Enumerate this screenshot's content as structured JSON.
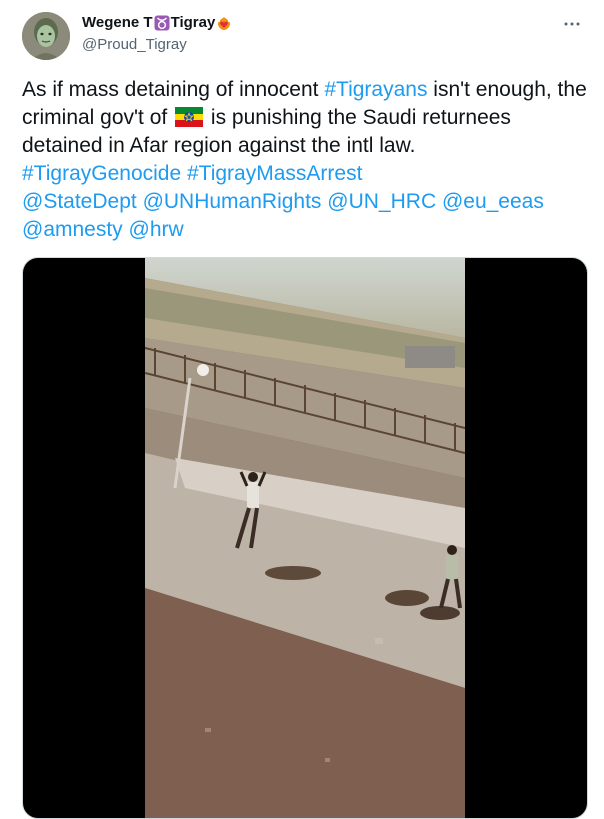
{
  "author": {
    "name_before": "Wegene T",
    "name_after": "Tigray",
    "handle": "@Proud_Tigray",
    "name_emoji": [
      "taurus-sign-icon",
      "heart-on-fire-icon"
    ]
  },
  "tweet": {
    "segments": [
      {
        "text": "As if mass detaining of innocent ",
        "type": "text"
      },
      {
        "text": "#Tigrayans",
        "type": "link"
      },
      {
        "text": " isn't enough, the criminal gov't of ",
        "type": "text"
      },
      {
        "type": "flag",
        "icon": "ethiopia-flag-icon"
      },
      {
        "text": " is punishing the Saudi returnees detained in Afar region against the intl law.",
        "type": "text"
      },
      {
        "type": "break"
      },
      {
        "text": "#TigrayGenocide",
        "type": "link"
      },
      {
        "text": " ",
        "type": "text"
      },
      {
        "text": "#TigrayMassArrest",
        "type": "link"
      },
      {
        "type": "break"
      },
      {
        "text": "@StateDept",
        "type": "link"
      },
      {
        "text": " ",
        "type": "text"
      },
      {
        "text": "@UNHumanRights",
        "type": "link"
      },
      {
        "text": " ",
        "type": "text"
      },
      {
        "text": "@UN_HRC",
        "type": "link"
      },
      {
        "text": " ",
        "type": "text"
      },
      {
        "text": "@eu_eeas",
        "type": "link"
      },
      {
        "type": "break"
      },
      {
        "text": "@amnesty",
        "type": "link"
      },
      {
        "text": " ",
        "type": "text"
      },
      {
        "text": "@hrw",
        "type": "link"
      }
    ]
  },
  "colors": {
    "link": "#1d9bf0",
    "text": "#0f1419",
    "secondary": "#536471"
  },
  "icons": {
    "more": "more-horizontal-icon"
  }
}
